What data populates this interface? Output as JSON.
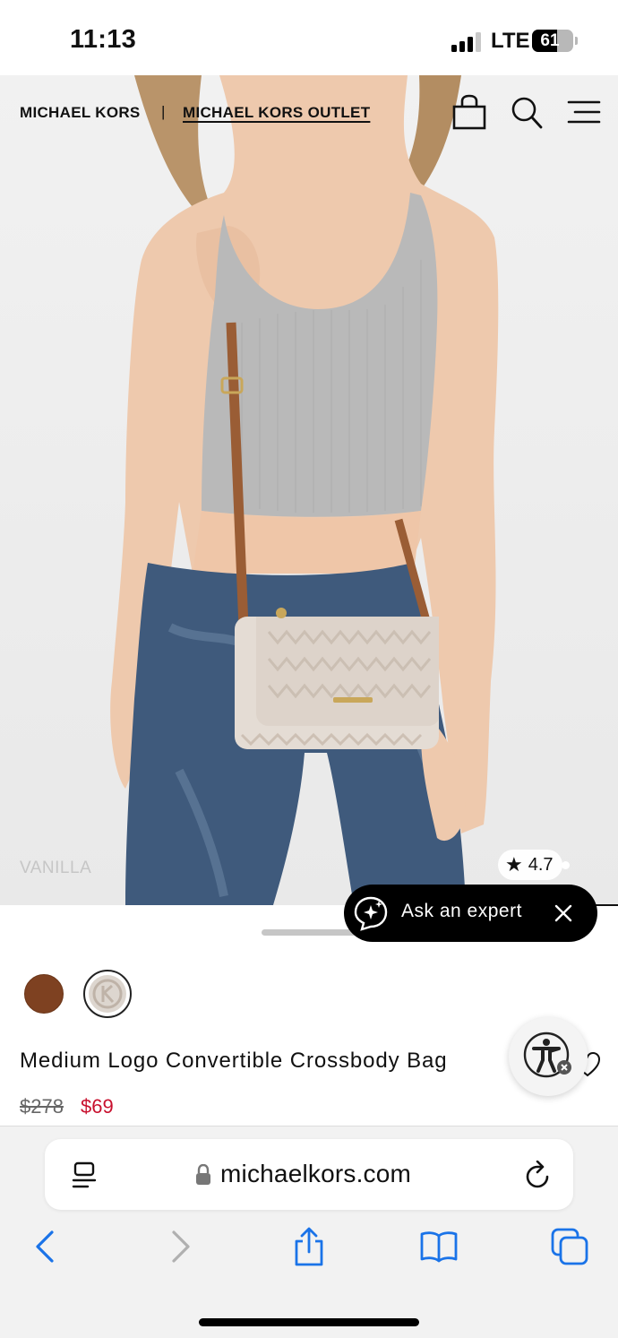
{
  "status_bar": {
    "time": "11:13",
    "network": "LTE",
    "battery": "61",
    "battery_level": 0.61,
    "signal_bars_active": 3,
    "signal_bars_total": 4
  },
  "site_nav": {
    "brand": "MICHAEL KORS",
    "separator": "|",
    "outlet": "MICHAEL KORS OUTLET",
    "icons": [
      "shopping-bag-icon",
      "search-icon",
      "menu-icon"
    ]
  },
  "hero": {
    "swatch_label": "VANILLA",
    "rating": "4.7",
    "rating_icon": "star-icon"
  },
  "expert_chat": {
    "label": "Ask an expert",
    "icon": "sparkle-chat-icon",
    "close_icon": "close-icon"
  },
  "product": {
    "colors": [
      {
        "name": "brown",
        "hex": "#7e4121",
        "selected": false
      },
      {
        "name": "vanilla",
        "hex": "#ddd6cf",
        "selected": true
      }
    ],
    "name": "Medium Logo Convertible Crossbody Bag",
    "price_original": "$278",
    "price_sale": "$69",
    "sale_color": "#c8102e"
  },
  "browser": {
    "url": "michaelkors.com",
    "toolbar": [
      "back-icon",
      "forward-icon",
      "share-icon",
      "bookmarks-icon",
      "tabs-icon"
    ],
    "accent": "#1a73e8"
  }
}
